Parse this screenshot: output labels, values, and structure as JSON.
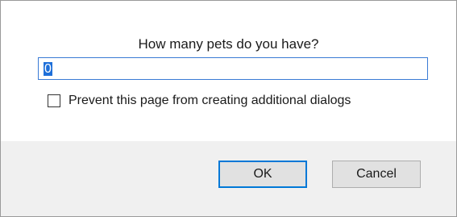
{
  "dialog": {
    "prompt": "How many pets do you have?",
    "input": {
      "value": "0",
      "placeholder": ""
    },
    "checkbox": {
      "label": "Prevent this page from creating additional dialogs",
      "checked": false
    },
    "buttons": {
      "ok_label": "OK",
      "cancel_label": "Cancel"
    },
    "colors": {
      "accent": "#0078d7",
      "selection": "#1e6fd9",
      "footer_bg": "#f0f0f0"
    }
  }
}
